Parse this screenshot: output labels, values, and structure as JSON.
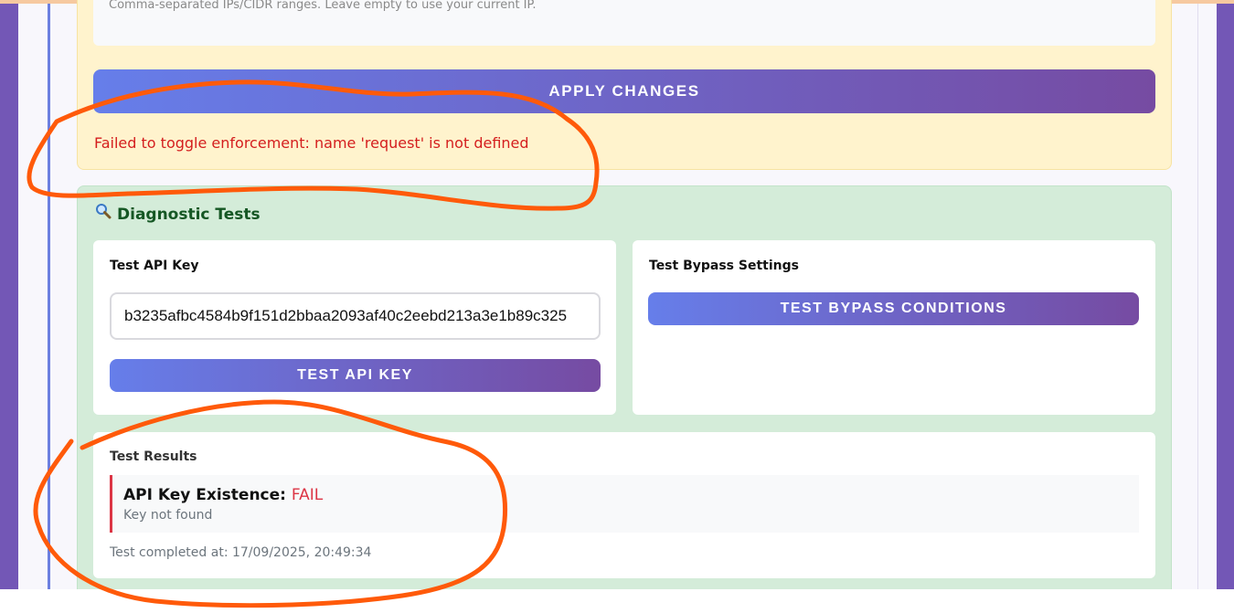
{
  "enforcement": {
    "ip_help_text": "Comma-separated IPs/CIDR ranges. Leave empty to use your current IP.",
    "apply_button_label": "APPLY CHANGES",
    "error_message": "Failed to toggle enforcement: name 'request' is not defined"
  },
  "diagnostics": {
    "title": "Diagnostic Tests",
    "title_icon": "magnifying-glass-icon",
    "test_api_key": {
      "title": "Test API Key",
      "input_value": "b3235afbc4584b9f151d2bbaa2093af40c2eebd213a3e1b89c325",
      "button_label": "TEST API KEY"
    },
    "test_bypass": {
      "title": "Test Bypass Settings",
      "button_label": "TEST BYPASS CONDITIONS"
    },
    "results": {
      "title": "Test Results",
      "items": [
        {
          "name": "API Key Existence:",
          "status": "FAIL",
          "detail": "Key not found"
        }
      ],
      "completed_text": "Test completed at: 17/09/2025, 20:49:34"
    }
  },
  "colors": {
    "accent_gradient_start": "#667eea",
    "accent_gradient_end": "#764ba2",
    "error": "#d41e1e",
    "fail": "#dc3545",
    "annotation": "#ff5a0a"
  }
}
